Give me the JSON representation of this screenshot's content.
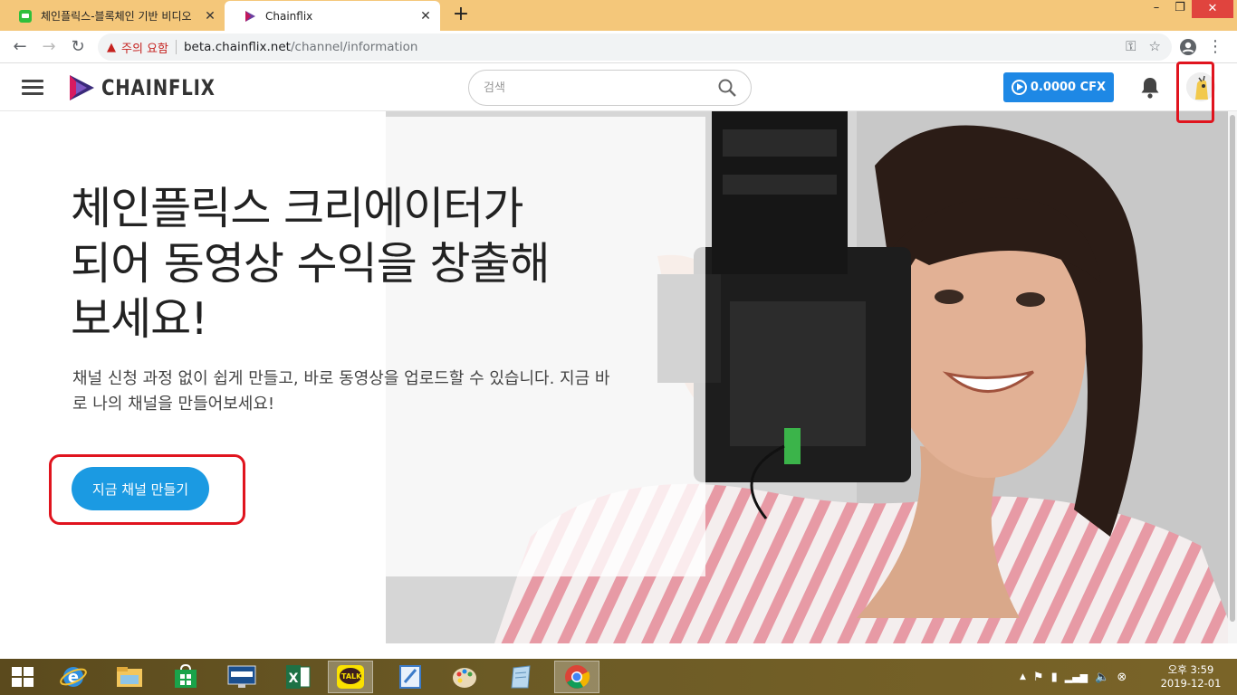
{
  "browser": {
    "tabs": [
      {
        "title": "체인플릭스-블록체인 기반 비디오",
        "state": "inactive"
      },
      {
        "title": "Chainflix",
        "state": "active"
      }
    ],
    "new_tab": "+",
    "window_controls": {
      "minimize": "–",
      "restore": "❐",
      "close": "✕"
    },
    "security_warning": "주의 요함",
    "url_host": "beta.chainflix.net",
    "url_path": "/channel/information"
  },
  "site": {
    "logo_text": "CHAINFLIX",
    "search_placeholder": "검색",
    "balance": "0.0000 CFX",
    "hero": {
      "title_line1": "체인플릭스 크리에이터가",
      "title_line2": "되어 동영상 수익을 창출해",
      "title_line3": "보세요!",
      "description": "채널 신청 과정 없이 쉽게 만들고, 바로 동영상을 업로드할 수 있습니다. 지금 바로 나의 채널을 만들어보세요!",
      "cta_label": "지금 채널 만들기"
    }
  },
  "taskbar": {
    "apps": [
      "start",
      "internet-explorer",
      "file-explorer",
      "store",
      "lenovo",
      "excel",
      "kakaotalk",
      "hangul",
      "paint",
      "notes",
      "chrome"
    ],
    "kakao_label": "TALK",
    "time": "오후 3:59",
    "date": "2019-12-01"
  },
  "colors": {
    "accent": "#1b9ae2",
    "cfx_button": "#1e88e5",
    "highlight": "#e0141e",
    "tab_strip": "#f4c77a"
  }
}
